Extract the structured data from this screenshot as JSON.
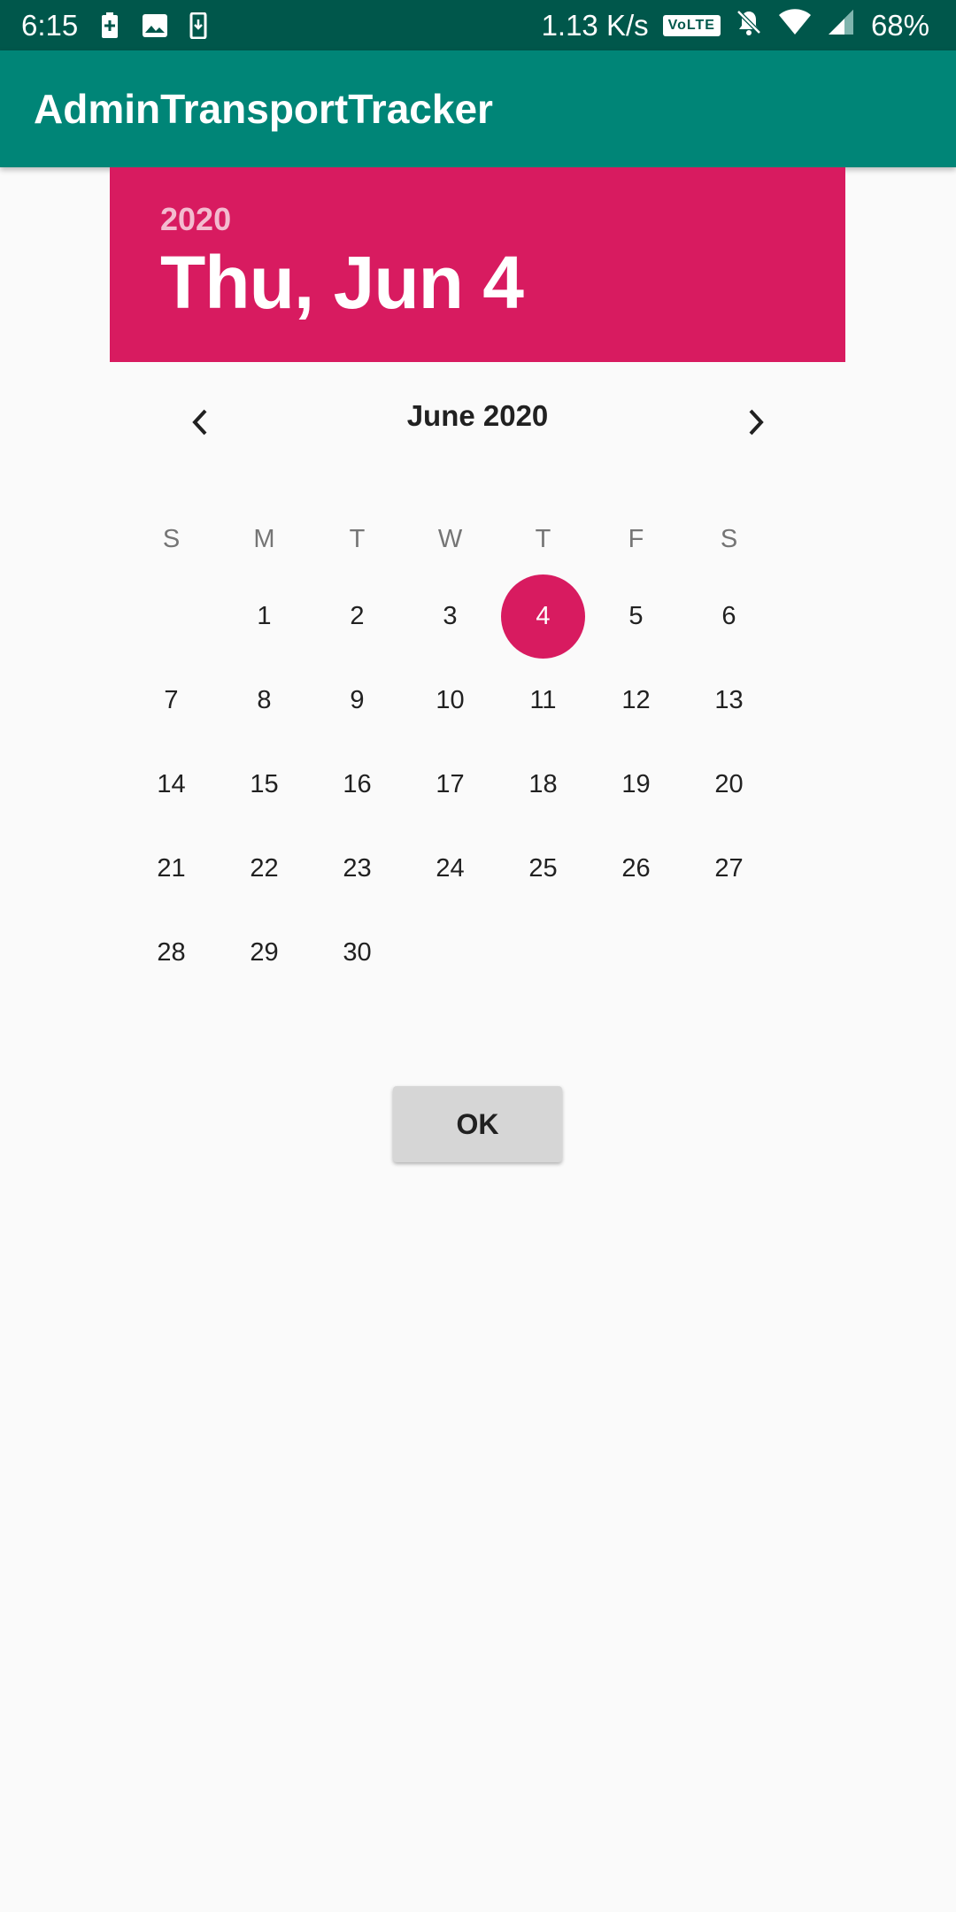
{
  "status_bar": {
    "time": "6:15",
    "network_speed": "1.13 K/s",
    "volte": "VoLTE",
    "battery_percent": "68%",
    "icons": [
      "battery-saver-icon",
      "image-icon",
      "download-icon",
      "volte-icon",
      "mute-icon",
      "wifi-icon",
      "signal-icon"
    ]
  },
  "app_bar": {
    "title": "AdminTransportTracker"
  },
  "picker": {
    "header_color": "#d81b60",
    "year": "2020",
    "selected_date": "Thu, Jun 4",
    "month_title": "June 2020",
    "weekdays": [
      "S",
      "M",
      "T",
      "W",
      "T",
      "F",
      "S"
    ],
    "weeks": [
      [
        "",
        "1",
        "2",
        "3",
        "4",
        "5",
        "6"
      ],
      [
        "7",
        "8",
        "9",
        "10",
        "11",
        "12",
        "13"
      ],
      [
        "14",
        "15",
        "16",
        "17",
        "18",
        "19",
        "20"
      ],
      [
        "21",
        "22",
        "23",
        "24",
        "25",
        "26",
        "27"
      ],
      [
        "28",
        "29",
        "30",
        "",
        "",
        "",
        ""
      ]
    ],
    "selected_day": "4",
    "ok_label": "OK"
  }
}
